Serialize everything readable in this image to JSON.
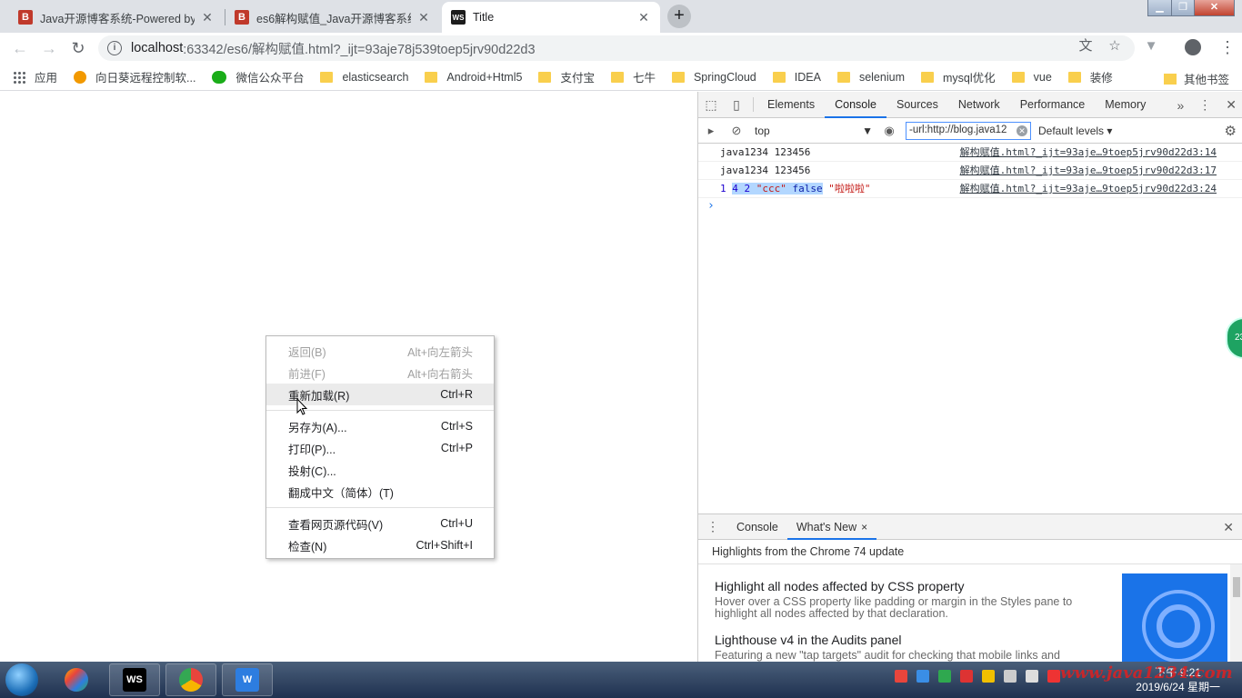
{
  "tabs": [
    {
      "title": "Java开源博客系统-Powered by",
      "favicon": "B",
      "favicon_color": "#c0392b",
      "active": false
    },
    {
      "title": "es6解构赋值_Java开源博客系统",
      "favicon": "B",
      "favicon_color": "#c0392b",
      "active": false
    },
    {
      "title": "Title",
      "favicon": "WS",
      "favicon_color": "#1c1c1c",
      "active": true
    }
  ],
  "address": {
    "host": "localhost",
    "path": ":63342/es6/解构赋值.html?_ijt=93aje78j539toep5jrv90d22d3"
  },
  "bookmarks": [
    {
      "label": "应用",
      "icon": "apps-icon"
    },
    {
      "label": "向日葵远程控制软...",
      "icon": "remote-icon"
    },
    {
      "label": "微信公众平台",
      "icon": "wechat-icon"
    },
    {
      "label": "elasticsearch",
      "icon": "folder-icon"
    },
    {
      "label": "Android+Html5",
      "icon": "folder-icon"
    },
    {
      "label": "支付宝",
      "icon": "folder-icon"
    },
    {
      "label": "七牛",
      "icon": "folder-icon"
    },
    {
      "label": "SpringCloud",
      "icon": "folder-icon"
    },
    {
      "label": "IDEA",
      "icon": "folder-icon"
    },
    {
      "label": "selenium",
      "icon": "folder-icon"
    },
    {
      "label": "mysql优化",
      "icon": "folder-icon"
    },
    {
      "label": "vue",
      "icon": "folder-icon"
    },
    {
      "label": "装修",
      "icon": "folder-icon"
    }
  ],
  "other_bookmarks": "其他书签",
  "context_menu": {
    "groups": [
      [
        {
          "label": "返回(B)",
          "shortcut": "Alt+向左箭头",
          "disabled": true
        },
        {
          "label": "前进(F)",
          "shortcut": "Alt+向右箭头",
          "disabled": true
        },
        {
          "label": "重新加载(R)",
          "shortcut": "Ctrl+R",
          "hover": true
        }
      ],
      [
        {
          "label": "另存为(A)...",
          "shortcut": "Ctrl+S"
        },
        {
          "label": "打印(P)...",
          "shortcut": "Ctrl+P"
        },
        {
          "label": "投射(C)...",
          "shortcut": ""
        },
        {
          "label": "翻成中文（简体）(T)",
          "shortcut": ""
        }
      ],
      [
        {
          "label": "查看网页源代码(V)",
          "shortcut": "Ctrl+U"
        },
        {
          "label": "检查(N)",
          "shortcut": "Ctrl+Shift+I"
        }
      ]
    ]
  },
  "devtools": {
    "tabs": [
      "Elements",
      "Console",
      "Sources",
      "Network",
      "Performance",
      "Memory"
    ],
    "active_tab": "Console",
    "more": "»",
    "console_toolbar": {
      "context": "top",
      "filter": "-url:http://blog.java12",
      "levels": "Default levels"
    },
    "messages": [
      {
        "text": "java1234 123456",
        "source": "解构赋值.html?_ijt=93aje…9toep5jrv90d22d3:14"
      },
      {
        "text": "java1234 123456",
        "source": "解构赋值.html?_ijt=93aje…9toep5jrv90d22d3:17"
      }
    ],
    "message3": {
      "n1": "1",
      "n2": "4",
      "n3": "2",
      "s1": "\"ccc\"",
      "kw": "false",
      "s2": "\"啦啦啦\"",
      "source": "解构赋值.html?_ijt=93aje…9toep5jrv90d22d3:24"
    },
    "prompt": "›",
    "drawer": {
      "tabs": [
        "Console",
        "What's New"
      ],
      "active": "What's New",
      "close_x": "×",
      "headline": "Highlights from the Chrome 74 update",
      "items": [
        {
          "title": "Highlight all nodes affected by CSS property",
          "desc": "Hover over a CSS property like padding or margin in the Styles pane to highlight all nodes affected by that declaration."
        },
        {
          "title": "Lighthouse v4 in the Audits panel",
          "desc": "Featuring a new \"tap targets\" audit for checking that mobile links and"
        }
      ]
    }
  },
  "badge": "23",
  "taskbar": {
    "apps": [
      {
        "label": "WS",
        "color": "#000000"
      },
      {
        "label": "",
        "color": "#e8453c"
      },
      {
        "label": "W",
        "color": "#2d7de0"
      }
    ],
    "time": "下午 9:21",
    "date": "2019/6/24 星期一"
  },
  "watermark": "www.java1234.com"
}
